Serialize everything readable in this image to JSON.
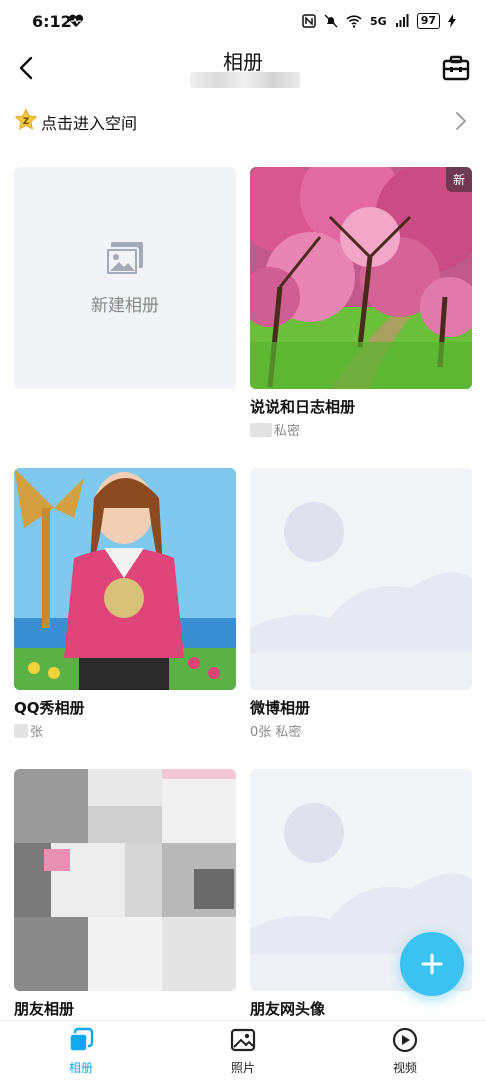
{
  "status_bar": {
    "time": "6:12",
    "network": "5G",
    "battery": "97"
  },
  "header": {
    "title": "相册",
    "back_icon": "chevron-left-icon",
    "toolbox_icon": "toolbox-icon"
  },
  "space_entry": {
    "label": "点击进入空间",
    "badge_text": "Z"
  },
  "new_album": {
    "label": "新建相册"
  },
  "albums": [
    {
      "name": "说说和日志相册",
      "meta": "私密",
      "badge": "新"
    },
    {
      "name": "QQ秀相册",
      "meta": "张"
    },
    {
      "name": "微博相册",
      "meta": "0张 私密"
    },
    {
      "name": "朋友相册",
      "meta": ""
    },
    {
      "name": "朋友网头像",
      "meta": ""
    }
  ],
  "fab": {
    "icon": "plus-icon"
  },
  "bottom_nav": [
    {
      "label": "相册",
      "icon": "album-icon",
      "active": true
    },
    {
      "label": "照片",
      "icon": "photo-icon",
      "active": false
    },
    {
      "label": "视频",
      "icon": "play-icon",
      "active": false
    }
  ],
  "colors": {
    "accent": "#12a8ee",
    "fab": "#3cc2f0",
    "text_primary": "#111111",
    "text_secondary": "#888888",
    "card_placeholder": "#f3f4f7"
  }
}
